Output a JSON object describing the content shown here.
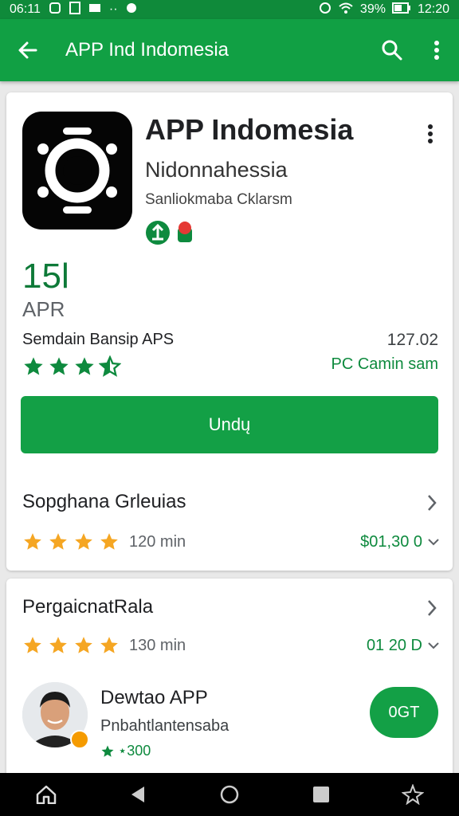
{
  "status_bar": {
    "carrier": "06:11",
    "battery": "39%",
    "time": "12:20"
  },
  "app_bar": {
    "title": "APP Ind Indomesia",
    "back_icon": "arrow-left-icon",
    "search_icon": "search-icon",
    "menu_icon": "more-vertical-icon"
  },
  "app": {
    "name": "APP Indomesia",
    "developer": "Nidonnahessia",
    "category": "Sanliokmaba Cklarsm",
    "stat_value": "15l",
    "stat_label": "APR",
    "subtitle": "Semdain Bansip APS",
    "size": "127.02",
    "rating_stars": 3.5,
    "platform_label": "PC Camin sam",
    "install_label": "Undų"
  },
  "section1": {
    "title": "Sopghana Grleuias",
    "stars": 4,
    "count": "120 min",
    "price": "$01,30 0"
  },
  "section2": {
    "title": "PergaicnatRala",
    "stars": 4,
    "count": "130 min",
    "price": "01 20 D"
  },
  "developer_card": {
    "title": "Dewtao APP",
    "subtitle": "Pnbahtlantensaba",
    "rating": "⋆300",
    "button_label": "0GT"
  },
  "colors": {
    "brand_green": "#11a044",
    "dark_green": "#0e7a38",
    "star_orange": "#f5a623"
  }
}
